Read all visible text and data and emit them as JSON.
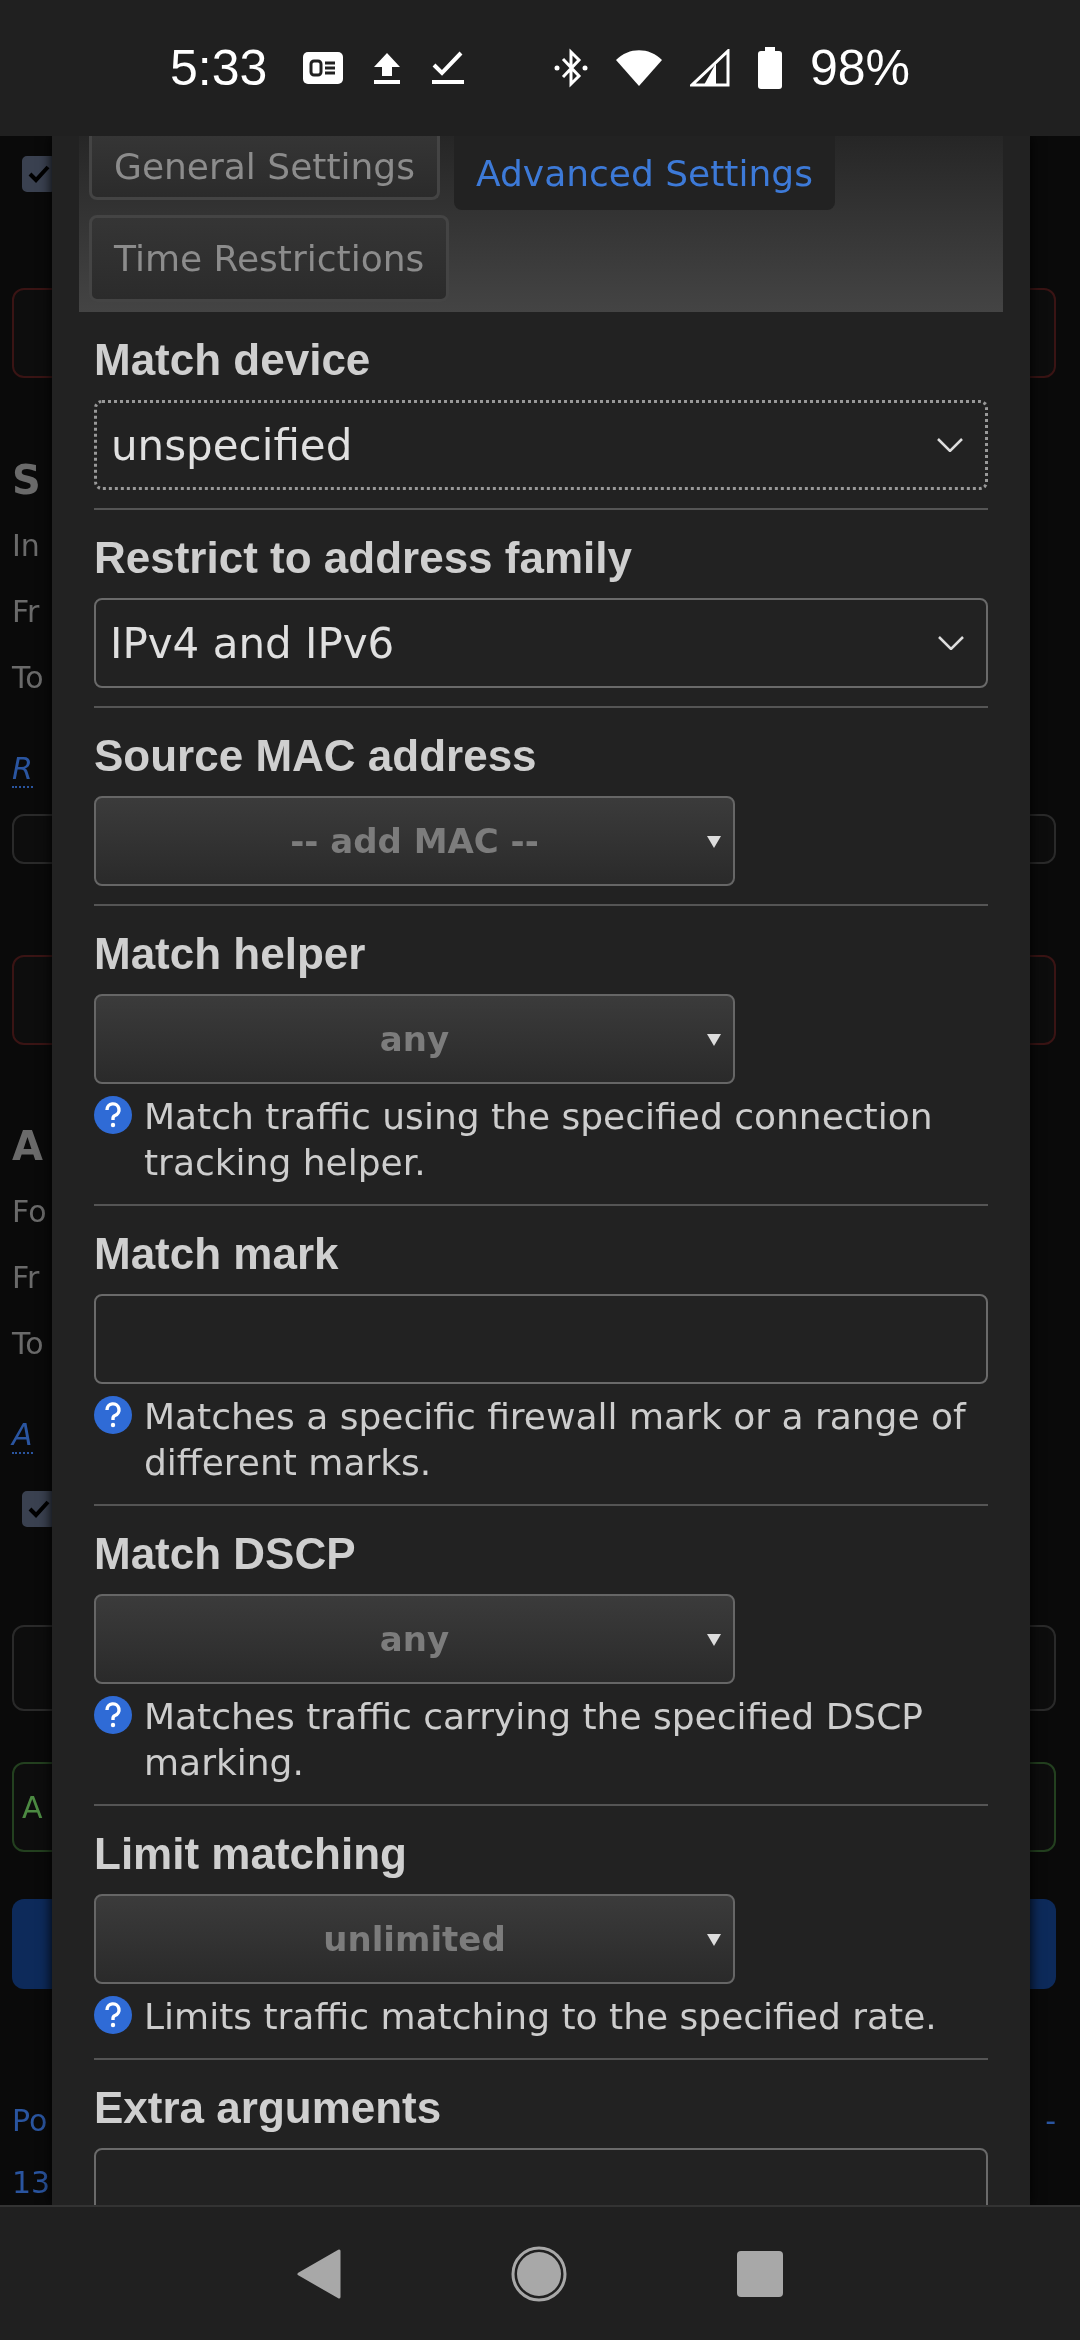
{
  "status_bar": {
    "time": "5:33",
    "battery": "98%"
  },
  "background_page": [
    {
      "kind": "checkbox",
      "checked": true
    },
    {
      "kind": "invalid_field"
    },
    {
      "kind": "heading",
      "text": "S"
    },
    {
      "kind": "text",
      "text": "In"
    },
    {
      "kind": "text",
      "text": "Fr"
    },
    {
      "kind": "text",
      "text": "To"
    },
    {
      "kind": "italic_link",
      "text": "R"
    },
    {
      "kind": "field"
    },
    {
      "kind": "invalid_field"
    },
    {
      "kind": "heading",
      "text": "A"
    },
    {
      "kind": "text",
      "text": "Fo"
    },
    {
      "kind": "text",
      "text": "Fr"
    },
    {
      "kind": "text",
      "text": "To"
    },
    {
      "kind": "italic_link",
      "text": "A"
    },
    {
      "kind": "checkbox",
      "checked": true
    },
    {
      "kind": "field"
    },
    {
      "kind": "add_button",
      "text": "A"
    },
    {
      "kind": "primary_button"
    },
    {
      "kind": "plain_link",
      "text": "Po",
      "right_text": "-"
    },
    {
      "kind": "plain_link",
      "text": "13"
    }
  ],
  "dialog": {
    "tabs": [
      {
        "label": "General Settings",
        "selected": false
      },
      {
        "label": "Advanced Settings",
        "selected": true
      },
      {
        "label": "Time Restrictions",
        "selected": false
      }
    ],
    "fields": [
      {
        "label": "Match device",
        "kind": "select",
        "value": "unspecified",
        "focused": true
      },
      {
        "label": "Restrict to address family",
        "kind": "select",
        "value": "IPv4 and IPv6",
        "focused": false
      },
      {
        "label": "Source MAC address",
        "kind": "dropdown",
        "value": "-- add MAC --"
      },
      {
        "label": "Match helper",
        "kind": "dropdown",
        "value": "any",
        "help": "Match traffic using the specified connection tracking helper."
      },
      {
        "label": "Match mark",
        "kind": "input",
        "help": "Matches a specific firewall mark or a range of different marks."
      },
      {
        "label": "Match DSCP",
        "kind": "dropdown",
        "value": "any",
        "help": "Matches traffic carrying the specified DSCP marking."
      },
      {
        "label": "Limit matching",
        "kind": "dropdown",
        "value": "unlimited",
        "help": "Limits traffic matching to the specified rate."
      },
      {
        "label": "Extra arguments",
        "kind": "input"
      }
    ]
  }
}
